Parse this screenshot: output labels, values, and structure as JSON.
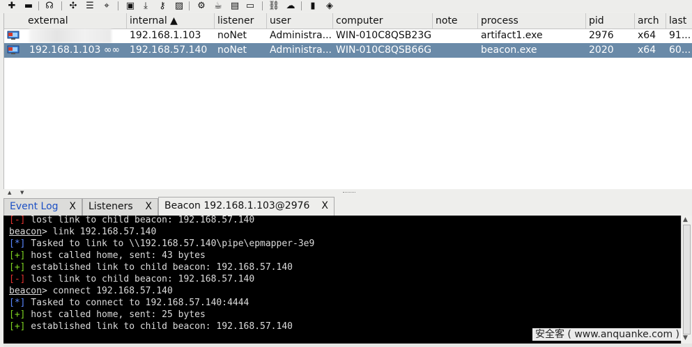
{
  "toolbar": {
    "buttons": [
      {
        "name": "new-connection-icon",
        "glyph": "✚"
      },
      {
        "name": "disconnect-icon",
        "glyph": "▬"
      },
      {
        "name": "headphones-icon",
        "glyph": "☊"
      },
      {
        "name": "pivot-graph-icon",
        "glyph": "✣"
      },
      {
        "name": "session-table-icon",
        "glyph": "☰"
      },
      {
        "name": "target-icon",
        "glyph": "⌖"
      },
      {
        "name": "credentials-icon",
        "glyph": "▣"
      },
      {
        "name": "download-icon",
        "glyph": "⤓"
      },
      {
        "name": "key-icon",
        "glyph": "⚷"
      },
      {
        "name": "screenshot-icon",
        "glyph": "▨"
      },
      {
        "name": "settings-gear-icon",
        "glyph": "⚙"
      },
      {
        "name": "coffee-icon",
        "glyph": "☕"
      },
      {
        "name": "document-icon",
        "glyph": "▤"
      },
      {
        "name": "console-icon",
        "glyph": "▭"
      },
      {
        "name": "link-icon",
        "glyph": "⛓"
      },
      {
        "name": "cloud-icon",
        "glyph": "☁"
      },
      {
        "name": "book-icon",
        "glyph": "▮"
      },
      {
        "name": "cube-icon",
        "glyph": "◈"
      }
    ]
  },
  "sessions": {
    "columns": [
      "external",
      "internal ▲",
      "listener",
      "user",
      "computer",
      "note",
      "process",
      "pid",
      "arch",
      "last"
    ],
    "rows": [
      {
        "external": "",
        "internal": "192.168.1.103",
        "listener": "noNet",
        "user": "Administra...",
        "computer": "WIN-010C8QSB23G",
        "note": "",
        "process": "artifact1.exe",
        "pid": "2976",
        "arch": "x64",
        "last": "91...",
        "selected": false
      },
      {
        "external": "192.168.1.103 ∞∞",
        "internal": "192.168.57.140",
        "listener": "noNet",
        "user": "Administra...",
        "computer": "WIN-010C8QSB66G",
        "note": "",
        "process": "beacon.exe",
        "pid": "2020",
        "arch": "x64",
        "last": "60...",
        "selected": true
      }
    ]
  },
  "tabs": [
    {
      "label": "Event Log",
      "close": "X",
      "active": false,
      "link": true
    },
    {
      "label": "Listeners",
      "close": "X",
      "active": false,
      "link": false
    },
    {
      "label": "Beacon 192.168.1.103@2976",
      "close": "X",
      "active": true,
      "link": false
    }
  ],
  "console": {
    "lines": [
      {
        "tag": "[-]",
        "kind": "err",
        "text": " lost link to child beacon: 192.168.57.140"
      },
      {
        "prompt": "beacon",
        "text": "> link 192.168.57.140"
      },
      {
        "tag": "[*]",
        "kind": "info",
        "text": " Tasked to link to \\\\192.168.57.140\\pipe\\epmapper-3e9"
      },
      {
        "tag": "[+]",
        "kind": "ok",
        "text": " host called home, sent: 43 bytes"
      },
      {
        "tag": "[+]",
        "kind": "ok",
        "text": " established link to child beacon: 192.168.57.140"
      },
      {
        "tag": "[-]",
        "kind": "err",
        "text": " lost link to child beacon: 192.168.57.140"
      },
      {
        "prompt": "beacon",
        "text": "> connect 192.168.57.140"
      },
      {
        "tag": "[*]",
        "kind": "info",
        "text": " Tasked to connect to 192.168.57.140:4444"
      },
      {
        "tag": "[+]",
        "kind": "ok",
        "text": " host called home, sent: 25 bytes"
      },
      {
        "tag": "[+]",
        "kind": "ok",
        "text": " established link to child beacon: 192.168.57.140"
      }
    ]
  },
  "watermark": "安全客 ( www.anquanke.com )",
  "colors": {
    "selected_row": "#6a8aa8",
    "console_bg": "#000000",
    "info_tag": "#5a87ff",
    "ok_tag": "#7ed321",
    "err_tag": "#e0322f",
    "link_tab": "#1c4fc4"
  }
}
